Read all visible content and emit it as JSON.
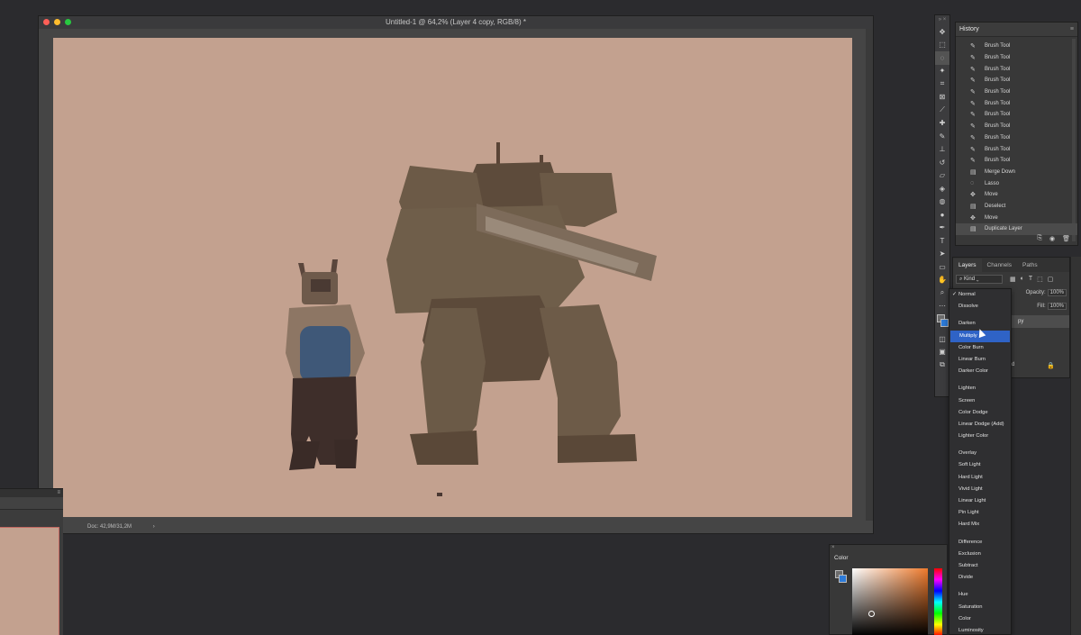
{
  "document": {
    "title": "Untitled-1 @ 64,2% (Layer 4 copy, RGB/8) *",
    "status": "Doc: 42,9M/31,2M",
    "status_arrow": "›"
  },
  "history": {
    "title": "History",
    "menu": "≡",
    "items": [
      {
        "label": "Brush Tool",
        "icon": "✎"
      },
      {
        "label": "Brush Tool",
        "icon": "✎"
      },
      {
        "label": "Brush Tool",
        "icon": "✎"
      },
      {
        "label": "Brush Tool",
        "icon": "✎"
      },
      {
        "label": "Brush Tool",
        "icon": "✎"
      },
      {
        "label": "Brush Tool",
        "icon": "✎"
      },
      {
        "label": "Brush Tool",
        "icon": "✎"
      },
      {
        "label": "Brush Tool",
        "icon": "✎"
      },
      {
        "label": "Brush Tool",
        "icon": "✎"
      },
      {
        "label": "Brush Tool",
        "icon": "✎"
      },
      {
        "label": "Brush Tool",
        "icon": "✎"
      },
      {
        "label": "Merge Down",
        "icon": "▤"
      },
      {
        "label": "Lasso",
        "icon": "◌"
      },
      {
        "label": "Move",
        "icon": "✥"
      },
      {
        "label": "Deselect",
        "icon": "▤"
      },
      {
        "label": "Move",
        "icon": "✥"
      },
      {
        "label": "Duplicate Layer",
        "icon": "▤"
      }
    ],
    "footer_icons": [
      "⎘",
      "◉",
      "🗑"
    ]
  },
  "layers": {
    "tabs": [
      "Layers",
      "Channels",
      "Paths"
    ],
    "kind_label": "Kind",
    "opacity_label": "Opacity:",
    "opacity_value": "100%",
    "fill_label": "Fill:",
    "fill_value": "100%",
    "layer_name_fragment": "py",
    "lock_fragment": "d"
  },
  "blend_modes": {
    "groups": [
      [
        "Normal",
        "Dissolve"
      ],
      [
        "Darken",
        "Multiply",
        "Color Burn",
        "Linear Burn",
        "Darker Color"
      ],
      [
        "Lighten",
        "Screen",
        "Color Dodge",
        "Linear Dodge (Add)",
        "Lighter Color"
      ],
      [
        "Overlay",
        "Soft Light",
        "Hard Light",
        "Vivid Light",
        "Linear Light",
        "Pin Light",
        "Hard Mix"
      ],
      [
        "Difference",
        "Exclusion",
        "Subtract",
        "Divide"
      ],
      [
        "Hue",
        "Saturation",
        "Color",
        "Luminosity"
      ]
    ],
    "checked": "Normal",
    "highlighted": "Multiply"
  },
  "color_panel": {
    "title": "Color",
    "close": "×"
  },
  "colors": {
    "canvas": "#c3a18f",
    "highlight": "#2f63c6",
    "background_swatch": "#2d7bd9",
    "foreground_swatch": "#6c6c6c"
  },
  "tools": [
    "move-icon",
    "marquee-icon",
    "lasso-icon",
    "magic-wand-icon",
    "crop-icon",
    "frame-icon",
    "eyedropper-icon",
    "healing-icon",
    "brush-icon",
    "stamp-icon",
    "history-brush-icon",
    "eraser-icon",
    "bucket-icon",
    "blur-icon",
    "dodge-icon",
    "pen-icon",
    "type-icon",
    "path-select-icon",
    "rectangle-icon",
    "hand-icon",
    "zoom-icon",
    "more-icon"
  ]
}
